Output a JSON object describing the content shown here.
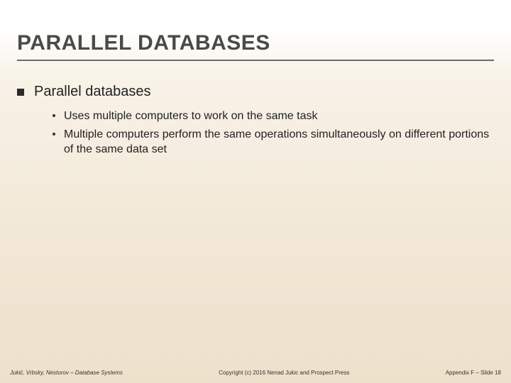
{
  "title": "PARALLEL DATABASES",
  "level1": {
    "text": "Parallel databases"
  },
  "level2": [
    {
      "text": "Uses multiple computers to work on the same task"
    },
    {
      "text": "Multiple computers perform the same operations simultaneously on different portions of the same data set"
    }
  ],
  "footer": {
    "left": "Jukić, Vrbsky, Nestorov – Database Systems",
    "center": "Copyright (c) 2016 Nenad Jukic and Prospect Press",
    "right": "Appendix F – Slide 18"
  }
}
